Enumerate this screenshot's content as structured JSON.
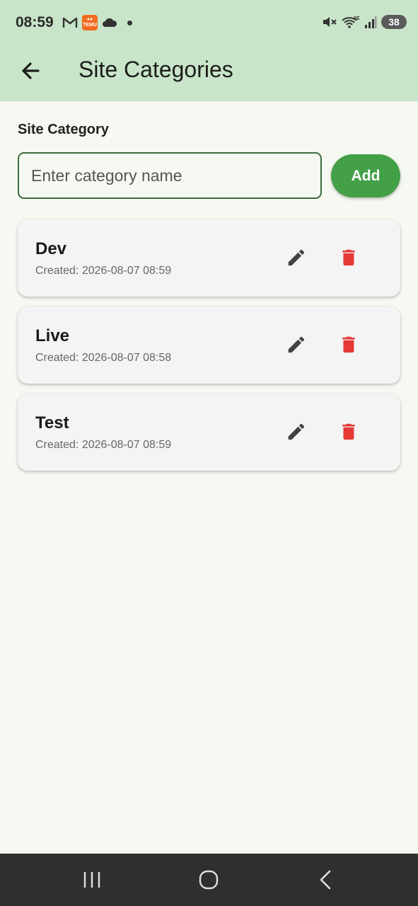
{
  "status_bar": {
    "time": "08:59",
    "battery": "38",
    "left_icons": [
      "gmail-icon",
      "temu-icon",
      "cloud-icon",
      "dot-icon"
    ],
    "right_icons": [
      "mute-icon",
      "wifi-6e-icon",
      "signal-icon",
      "battery-icon"
    ]
  },
  "header": {
    "title": "Site Categories",
    "back_icon": "arrow-back-icon"
  },
  "form": {
    "label": "Site Category",
    "placeholder": "Enter category name",
    "value": "",
    "add_label": "Add"
  },
  "categories": [
    {
      "name": "Dev",
      "created": "Created: 2026-08-07 08:59"
    },
    {
      "name": "Live",
      "created": "Created: 2026-08-07 08:58"
    },
    {
      "name": "Test",
      "created": "Created: 2026-08-07 08:59"
    }
  ],
  "colors": {
    "header_bg": "#c9e5c9",
    "page_bg": "#f6f9f1",
    "accent": "#43a047",
    "delete": "#e53935",
    "edit": "#424242"
  },
  "nav": [
    "recents-icon",
    "home-icon",
    "back-icon"
  ]
}
